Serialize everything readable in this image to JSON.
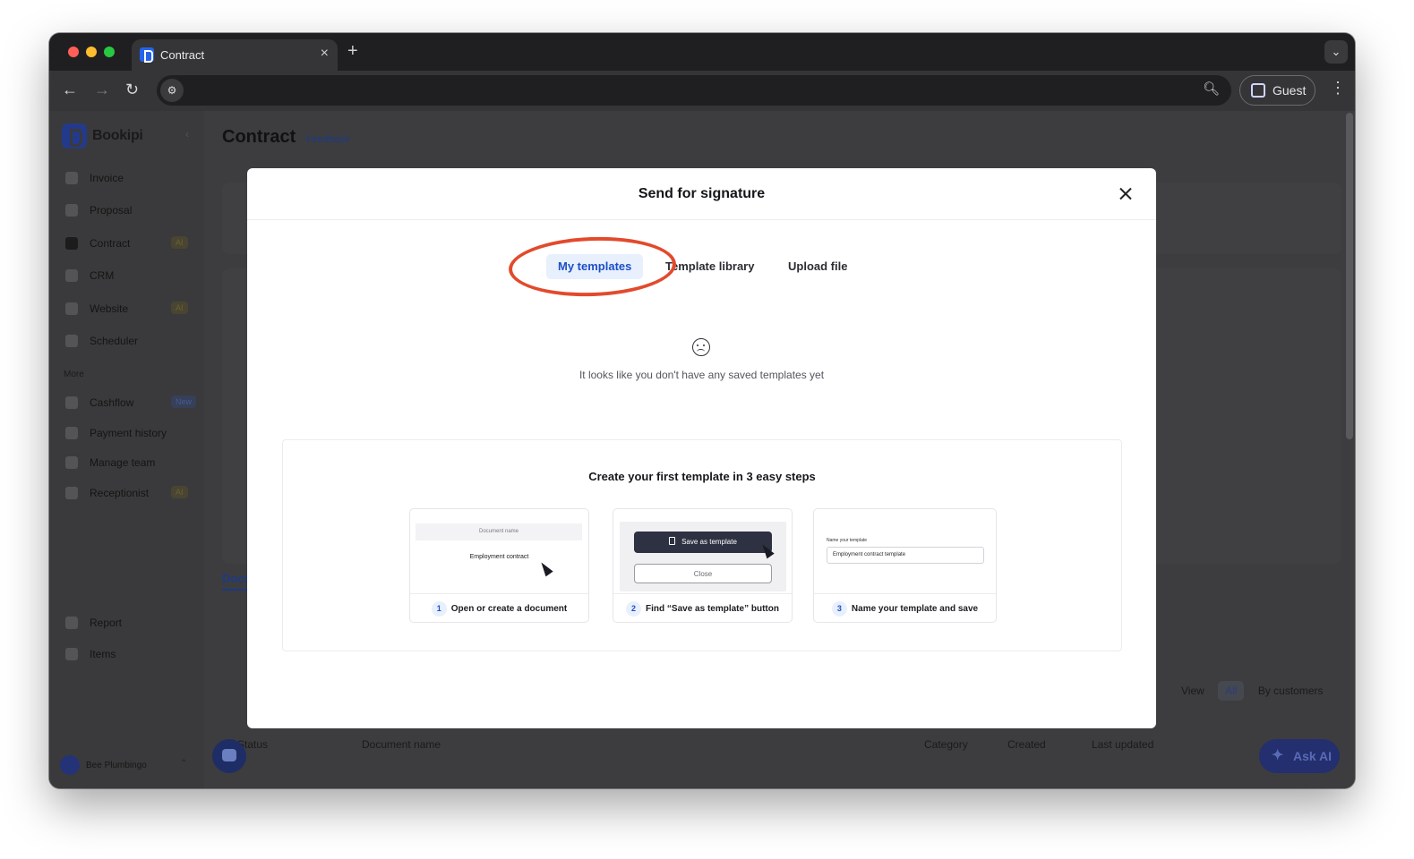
{
  "browser": {
    "tab_title": "Contract",
    "new_tab_symbol": "+",
    "close_symbol": "×",
    "guest_label": "Guest"
  },
  "sidebar": {
    "brand": "Bookipi",
    "items": [
      {
        "label": "Invoice",
        "badge": ""
      },
      {
        "label": "Proposal",
        "badge": ""
      },
      {
        "label": "Contract",
        "badge": "AI"
      },
      {
        "label": "CRM",
        "badge": ""
      },
      {
        "label": "Website",
        "badge": "AI"
      },
      {
        "label": "Scheduler",
        "badge": ""
      }
    ],
    "more_label": "More",
    "more_items": [
      {
        "label": "Cashflow",
        "badge": "New"
      },
      {
        "label": "Payment history",
        "badge": ""
      },
      {
        "label": "Manage team",
        "badge": ""
      },
      {
        "label": "Receptionist",
        "badge": "AI"
      }
    ],
    "bottom_items": [
      {
        "label": "Report"
      },
      {
        "label": "Items"
      }
    ],
    "account_name": "Bee Plumbingo"
  },
  "main": {
    "title": "Contract",
    "feedback": "Feedback",
    "docs_tab": "Docu",
    "view_label": "View",
    "view_all": "All",
    "view_by_customers": "By customers",
    "table_headers": [
      "Status",
      "Document name",
      "Category",
      "Created",
      "Last updated"
    ],
    "ask_ai": "Ask AI"
  },
  "modal": {
    "title": "Send for signature",
    "tabs": {
      "my_templates": "My templates",
      "template_library": "Template library",
      "upload_file": "Upload file"
    },
    "empty_text": "It looks like you don't have any saved templates yet",
    "steps_title": "Create your first template in 3 easy steps",
    "steps": [
      {
        "num": "1",
        "caption": "Open or create a document"
      },
      {
        "num": "2",
        "caption": "Find “Save as template” button"
      },
      {
        "num": "3",
        "caption": "Name your template and save"
      }
    ],
    "preview1": {
      "field_label": "Document name",
      "field_value": "Employment contract"
    },
    "preview2": {
      "save_button": "Save as template",
      "close_button": "Close"
    },
    "preview3": {
      "label": "Name your template",
      "value": "Employment contract template"
    }
  },
  "colors": {
    "accent": "#1c4fc7",
    "highlight_ring": "#e24a2c",
    "overlay": "#3d3d3f"
  }
}
